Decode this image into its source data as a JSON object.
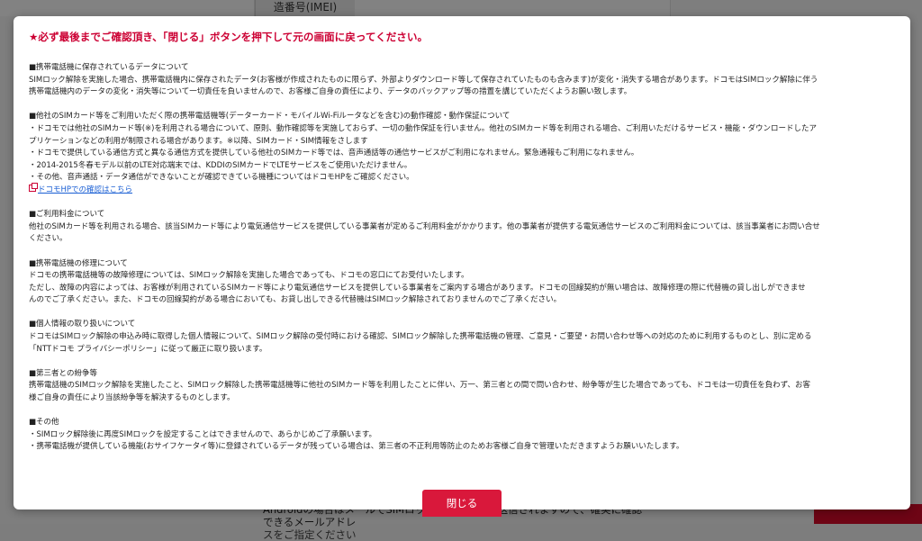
{
  "background": {
    "imei_label": "造番号(IMEI)",
    "bottom_text_line1": "Androidの場合はメールでSIMロック解除コードが送信されますので、確実に確認できるメールアドレ",
    "bottom_text_line2": "スをご指定ください"
  },
  "modal": {
    "heading": "★必ず最後までご確認頂き、「閉じる」ボタンを押下して元の画面に戻ってください。",
    "sections": [
      {
        "title": "■携帯電話機に保存されているデータについて",
        "lines": [
          "SIMロック解除を実施した場合、携帯電話機内に保存されたデータ(お客様が作成されたものに限らず、外部よりダウンロード等して保存されていたものも含みます)が変化・消失する場合があります。ドコモはSIMロック解除に伴う",
          "携帯電話機内のデータの変化・消失等について一切責任を負いませんので、お客様ご自身の責任により、データのバックアップ等の措置を講じていただくようお願い致します。"
        ]
      },
      {
        "title": "■他社のSIMカード等をご利用いただく際の携帯電話機等(データーカード・モバイルWi-Fiルータなどを含む)の動作確認・動作保証について",
        "lines": [
          "・ドコモでは他社のSIMカード等(※)を利用される場合について、原則、動作確認等を実施しておらず、一切の動作保証を行いません。他社のSIMカード等を利用される場合、ご利用いただけるサービス・機能・ダウンロードしたア",
          "プリケーションなどの利用が制限される場合があります。※以降、SIMカード・SIM情報をさします",
          "・ドコモで提供している通信方式と異なる通信方式を提供している他社のSIMカード等では、音声通話等の通信サービスがご利用になれません。緊急通報もご利用になれません。",
          "・2014-2015冬春モデル以前のLTE対応端末では、KDDIのSIMカードでLTEサービスをご使用いただけません。",
          "・その他、音声通話・データ通信ができないことが確認できている機種についてはドコモHPをご確認ください。"
        ],
        "link": "ドコモHPでの確認はこちら"
      },
      {
        "title": "■ご利用料金について",
        "lines": [
          "他社のSIMカード等を利用される場合、該当SIMカード等により電気通信サービスを提供している事業者が定めるご利用料金がかかります。他の事業者が提供する電気通信サービスのご利用料金については、該当事業者にお問い合せ",
          "ください。"
        ]
      },
      {
        "title": "■携帯電話機の修理について",
        "lines": [
          "ドコモの携帯電話機等の故障修理については、SIMロック解除を実施した場合であっても、ドコモの窓口にてお受付いたします。",
          "ただし、故障の内容によっては、お客様が利用されているSIMカード等により電気通信サービスを提供している事業者をご案内する場合があります。ドコモの回線契約が無い場合は、故障修理の際に代替機の貸し出しができませ",
          "んのでご了承ください。また、ドコモの回線契約がある場合においても、お貸し出しできる代替機はSIMロック解除されておりませんのでご了承ください。"
        ]
      },
      {
        "title": "■個人情報の取り扱いについて",
        "lines": [
          "ドコモはSIMロック解除の申込み時に取得した個人情報について、SIMロック解除の受付時における確認、SIMロック解除した携帯電話機の管理、ご意見・ご要望・お問い合わせ等への対応のために利用するものとし、別に定める",
          "「NTTドコモ プライバシーポリシー」に従って厳正に取り扱います。"
        ]
      },
      {
        "title": "■第三者との紛争等",
        "lines": [
          "携帯電話機のSIMロック解除を実施したこと、SIMロック解除した携帯電話機等に他社のSIMカード等を利用したことに伴い、万一、第三者との間で問い合わせ、紛争等が生じた場合であっても、ドコモは一切責任を負わず、お客",
          "様ご自身の責任により当該紛争等を解決するものとします。"
        ]
      },
      {
        "title": "■その他",
        "lines": [
          "・SIMロック解除後に再度SIMロックを設定することはできませんので、あらかじめご了承願います。",
          "・携帯電話機が提供している機能(おサイフケータイ等)に登録されているデータが残っている場合は、第三者の不正利用等防止のためお客様ご自身で管理いただきますようお願いいたします。"
        ]
      }
    ],
    "close_label": "閉じる"
  },
  "colors": {
    "accent_red": "#cc0033",
    "button_red": "#d9183b",
    "link_blue": "#1a5fd4"
  }
}
